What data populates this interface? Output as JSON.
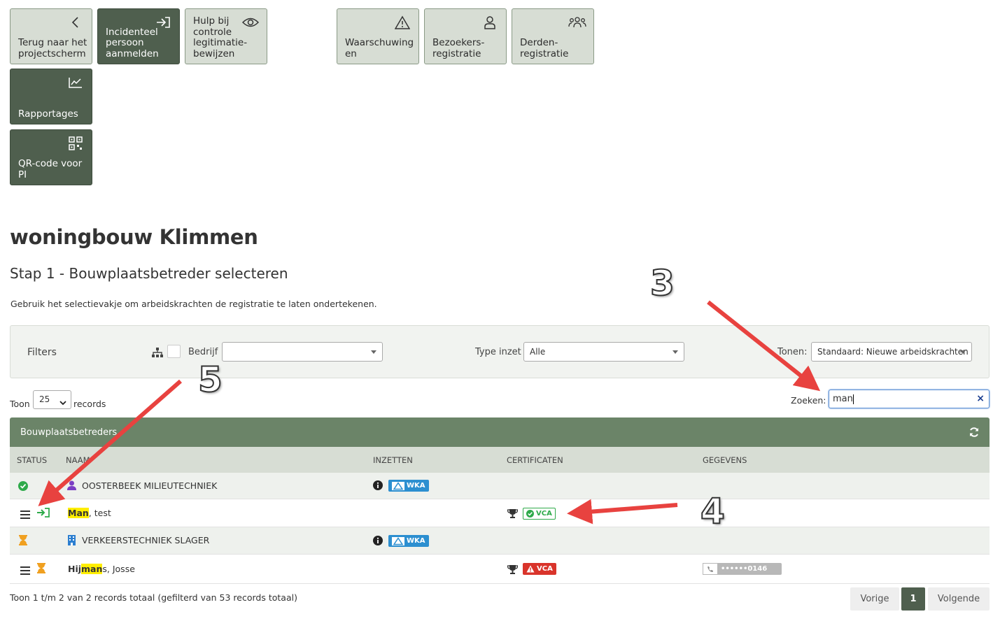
{
  "tiles": {
    "back": "Terug naar het projectscherm",
    "incident": "Incidenteel persoon aanmelden",
    "help": "Hulp bij controle legitimatie-bewijzen",
    "warnings": "Waarschuwingen",
    "visitors": "Bezoekers-registratie",
    "third_party": "Derden-registratie",
    "reports": "Rapportages",
    "qr": "QR-code voor PI"
  },
  "page": {
    "title": "woningbouw Klimmen",
    "step": "Stap 1 - Bouwplaatsbetreder selecteren",
    "intro": "Gebruik het selectievakje om arbeidskrachten de registratie te laten ondertekenen."
  },
  "filters": {
    "title": "Filters",
    "company_label": "Bedrijf",
    "company_value": "",
    "type_label": "Type inzet",
    "type_value": "Alle",
    "show_label": "Tonen:",
    "show_value": "Standaard: Nieuwe arbeidskrachten"
  },
  "length": {
    "before": "Toon",
    "value": "25",
    "after": "records"
  },
  "search": {
    "label": "Zoeken:",
    "value": "man"
  },
  "table": {
    "title": "Bouwplaatsbetreders",
    "columns": [
      "STATUS",
      "NAAM",
      "INZETTEN",
      "CERTIFICATEN",
      "GEGEVENS"
    ],
    "rows": [
      {
        "name": "OOSTERBEEK MILIEUTECHNIEK",
        "inzet_badge": "WKA"
      },
      {
        "name_hl": "Man",
        "name_rest": ", test",
        "cert_badge": "VCA"
      },
      {
        "name": "VERKEERSTECHNIEK SLAGER",
        "inzet_badge": "WKA"
      },
      {
        "name_pre": "Hij",
        "name_hl": "man",
        "name_rest": "s, Josse",
        "cert_badge": "VCA",
        "phone": "••••••0146"
      }
    ]
  },
  "footer": {
    "info": "Toon 1 t/m 2 van 2 records totaal (gefilterd van 53 records totaal)",
    "prev": "Vorige",
    "page": "1",
    "next": "Volgende"
  },
  "annotations": [
    "3",
    "4",
    "5"
  ],
  "colors": {
    "accent": "#6b8468",
    "dark_tile": "#4f5f4e",
    "light_tile": "#d7ddd4",
    "annotation_arrow": "#e8423f",
    "highlight": "#ffee00",
    "ok": "#2eaa4a",
    "warn": "#d9342b",
    "pending": "#f0a020"
  }
}
